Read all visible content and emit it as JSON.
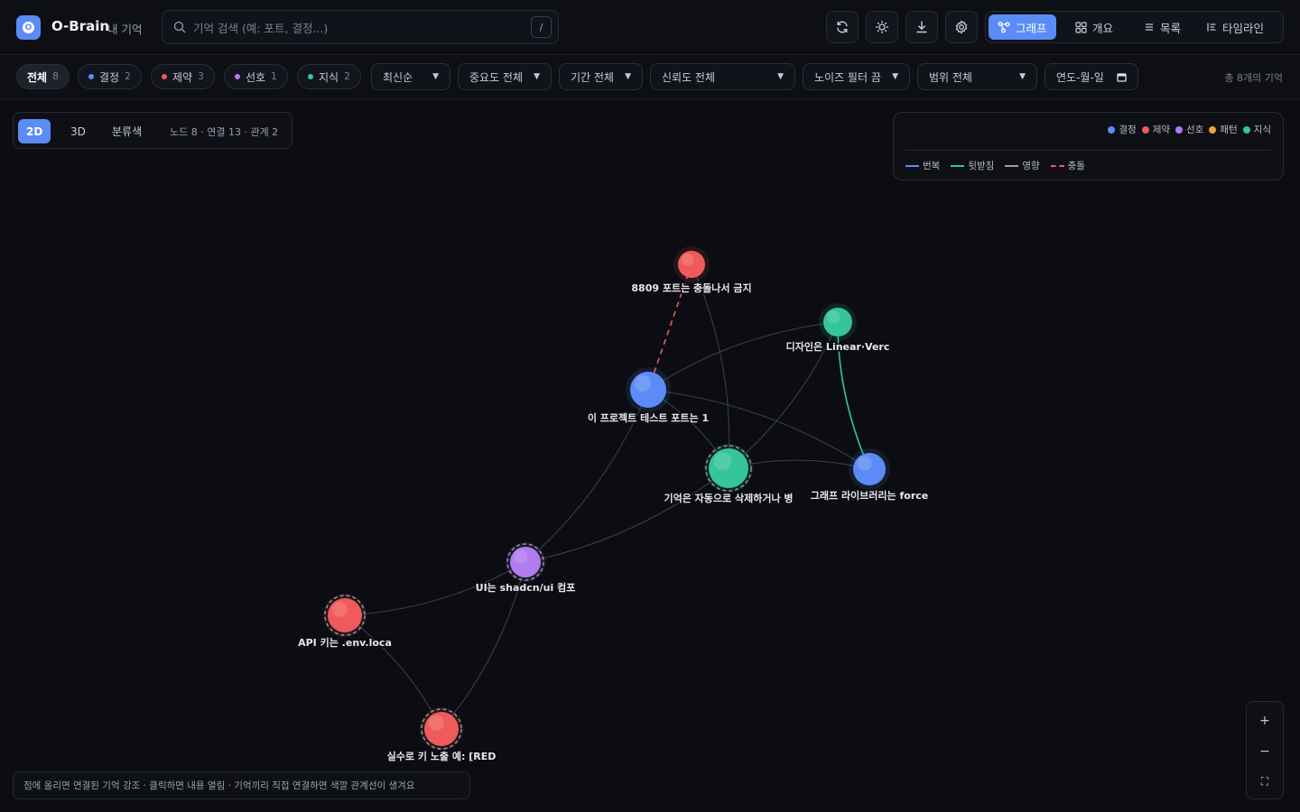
{
  "app": {
    "brand": "O-Brain",
    "subtitle": "내 기억",
    "logo_letter": "O"
  },
  "search": {
    "placeholder": "기억 검색 (예: 포트, 결정...)",
    "shortcut": "/"
  },
  "toolbar": {
    "icons": [
      "refresh-icon",
      "sun-icon",
      "download-icon",
      "gear-icon"
    ]
  },
  "views": [
    {
      "label": "그래프",
      "icon": "graph-icon",
      "active": true
    },
    {
      "label": "개요",
      "icon": "grid-icon",
      "active": false
    },
    {
      "label": "목록",
      "icon": "list-icon",
      "active": false
    },
    {
      "label": "타임라인",
      "icon": "timeline-icon",
      "active": false
    }
  ],
  "filters": {
    "chips": [
      {
        "label": "전체",
        "count": "8",
        "active": true,
        "color": ""
      },
      {
        "label": "결정",
        "count": "2",
        "active": false,
        "color": "#5b8cf6"
      },
      {
        "label": "제약",
        "count": "3",
        "active": false,
        "color": "#ef5a5a"
      },
      {
        "label": "선호",
        "count": "1",
        "active": false,
        "color": "#b07cf0"
      },
      {
        "label": "지식",
        "count": "2",
        "active": false,
        "color": "#34c59a"
      }
    ],
    "sort": "최신순",
    "importance": "중요도 전체",
    "period": "기간 전체",
    "confidence": "신뢰도 전체",
    "noise": "노이즈 필터 끔",
    "scope": "범위 전체",
    "date_placeholder": "연도-월-일",
    "total": "총 8개의 기억"
  },
  "graph_controls": {
    "modes": [
      "2D",
      "3D",
      "분류색"
    ],
    "active_mode": "2D",
    "stats": "노드 8 · 연결 13 · 관계 2"
  },
  "legend": {
    "categories": [
      {
        "label": "결정",
        "color": "#5b8cf6"
      },
      {
        "label": "제약",
        "color": "#ef5a5a"
      },
      {
        "label": "선호",
        "color": "#b07cf0"
      },
      {
        "label": "패턴",
        "color": "#f0a23a"
      },
      {
        "label": "지식",
        "color": "#34c59a"
      }
    ],
    "relations": [
      {
        "label": "번복",
        "color": "#5b8cf6",
        "dashed": false
      },
      {
        "label": "뒷받침",
        "color": "#34c59a",
        "dashed": false
      },
      {
        "label": "영향",
        "color": "#9aa0ad",
        "dashed": false
      },
      {
        "label": "충돌",
        "color": "#ef5a5a",
        "dashed": true
      }
    ]
  },
  "nodes": [
    {
      "id": "n1",
      "label": "8809 포트는 충돌나서 금지",
      "category": "제약"
    },
    {
      "id": "n2",
      "label": "디자인은 Linear·Verc",
      "category": "지식"
    },
    {
      "id": "n3",
      "label": "이 프로젝트 테스트 포트는 1",
      "category": "결정"
    },
    {
      "id": "n4",
      "label": "기억은 자동으로 삭제하거나 병",
      "category": "지식"
    },
    {
      "id": "n5",
      "label": "그래프 라이브러리는 force",
      "category": "결정"
    },
    {
      "id": "n6",
      "label": "UI는 shadcn/ui 컴포",
      "category": "선호"
    },
    {
      "id": "n7",
      "label": "API 키는 .env.loca",
      "category": "제약"
    },
    {
      "id": "n8",
      "label": "실수로 키 노출 예: [RED",
      "category": "제약"
    }
  ],
  "edges": [
    {
      "from": "n1",
      "to": "n3",
      "relation": "충돌"
    },
    {
      "from": "n2",
      "to": "n5",
      "relation": "뒷받침"
    },
    {
      "from": "n1",
      "to": "n4",
      "relation": ""
    },
    {
      "from": "n3",
      "to": "n2",
      "relation": ""
    },
    {
      "from": "n3",
      "to": "n4",
      "relation": ""
    },
    {
      "from": "n3",
      "to": "n5",
      "relation": ""
    },
    {
      "from": "n2",
      "to": "n4",
      "relation": ""
    },
    {
      "from": "n4",
      "to": "n5",
      "relation": ""
    },
    {
      "from": "n4",
      "to": "n6",
      "relation": ""
    },
    {
      "from": "n3",
      "to": "n6",
      "relation": ""
    },
    {
      "from": "n6",
      "to": "n7",
      "relation": ""
    },
    {
      "from": "n6",
      "to": "n8",
      "relation": ""
    },
    {
      "from": "n7",
      "to": "n8",
      "relation": ""
    }
  ],
  "zoom": {
    "in": "+",
    "out": "−",
    "fit": "⛶"
  },
  "hint": "점에 올리면 연결된 기억 강조 · 클릭하면 내용 열림 · 기억끼리 직접 연결하면 색깔 관계선이 생겨요"
}
